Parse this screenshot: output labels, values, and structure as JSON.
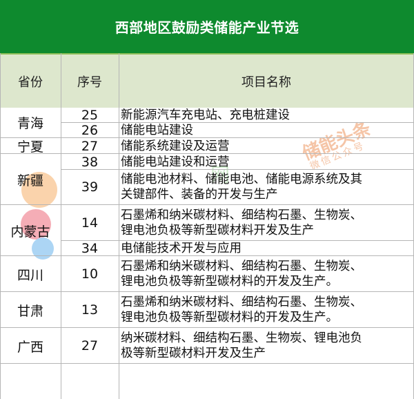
{
  "title": "西部地区鼓励类储能产业节选",
  "headers": {
    "province": "省份",
    "number": "序号",
    "project": "项目名称"
  },
  "rows": [
    {
      "province": "青海",
      "items": [
        {
          "number": "25",
          "project": [
            "新能源汽车充电站、充电桩建设"
          ]
        },
        {
          "number": "26",
          "project": [
            "储能电站建设"
          ]
        }
      ]
    },
    {
      "province": "宁夏",
      "items": [
        {
          "number": "27",
          "project": [
            "储能系统建设及运营"
          ]
        }
      ]
    },
    {
      "province": "新疆",
      "items": [
        {
          "number": "38",
          "project": [
            "储能电站建设和运营"
          ]
        },
        {
          "number": "39",
          "project": [
            "储能电池材料、储能电池、储能电源系统及其",
            "关键部件、装备的开发与生产"
          ]
        }
      ]
    },
    {
      "province": "内蒙古",
      "items": [
        {
          "number": "14",
          "project": [
            "石墨烯和纳米碳材料、细结构石墨、生物炭、",
            "锂电池负极等新型碳材料开发及生产"
          ]
        },
        {
          "number": "34",
          "project": [
            "电储能技术开发与应用"
          ]
        }
      ]
    },
    {
      "province": "四川",
      "items": [
        {
          "number": "10",
          "project": [
            "石墨烯和纳米碳材料、细结构石墨、生物炭、",
            "锂电池负极等新型碳材料的开发及生产。"
          ]
        }
      ]
    },
    {
      "province": "甘肃",
      "items": [
        {
          "number": "13",
          "project": [
            "石墨烯和纳米碳材料、细结构石墨、生物炭、",
            "锂电池负极等新型碳材料的开发及生产。"
          ]
        }
      ]
    },
    {
      "province": "广西",
      "items": [
        {
          "number": "27",
          "project": [
            "纳米碳材料、细结构石墨、生物炭、锂电池负",
            "极等新型碳材料开发及生产"
          ]
        }
      ]
    }
  ],
  "watermark": {
    "brand": "储能头条",
    "sub": "微信公众号",
    "site": "网"
  },
  "colors": {
    "title_bg": "#0e8a2e",
    "header_bg": "#dde7cd",
    "grid": "#b5b5b5"
  }
}
